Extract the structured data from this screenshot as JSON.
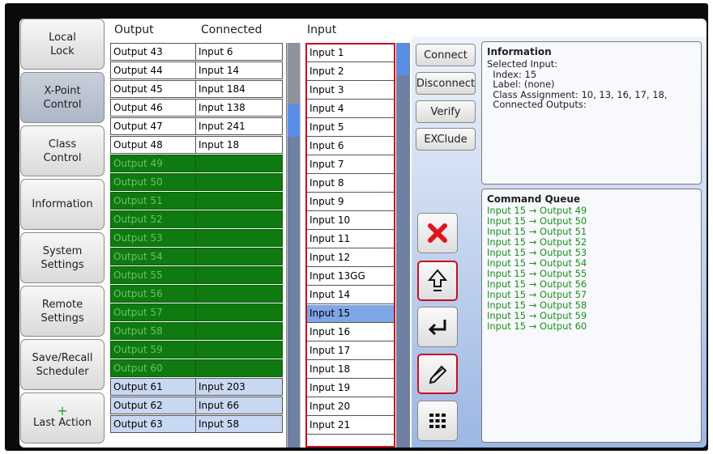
{
  "nav": [
    {
      "label": "Local\nLock",
      "active": false
    },
    {
      "label": "X-Point\nControl",
      "active": true
    },
    {
      "label": "Class\nControl",
      "active": false
    },
    {
      "label": "Information",
      "active": false
    },
    {
      "label": "System\nSettings",
      "active": false
    },
    {
      "label": "Remote\nSettings",
      "active": false
    },
    {
      "label": "Save/Recall\nScheduler",
      "active": false
    },
    {
      "label": "Last Action",
      "active": false,
      "plus": "+"
    }
  ],
  "headers": {
    "output": "Output",
    "connected": "Connected",
    "input": "Input"
  },
  "outputs": [
    {
      "output": "Output 43",
      "connected": "Input 6",
      "state": "normal"
    },
    {
      "output": "Output 44",
      "connected": "Input 14",
      "state": "normal"
    },
    {
      "output": "Output 45",
      "connected": "Input 184",
      "state": "normal"
    },
    {
      "output": "Output 46",
      "connected": "Input 138",
      "state": "normal"
    },
    {
      "output": "Output 47",
      "connected": "Input 241",
      "state": "normal"
    },
    {
      "output": "Output 48",
      "connected": "Input 18",
      "state": "normal"
    },
    {
      "output": "Output 49",
      "connected": "",
      "state": "queued"
    },
    {
      "output": "Output 50",
      "connected": "",
      "state": "queued"
    },
    {
      "output": "Output 51",
      "connected": "",
      "state": "queued"
    },
    {
      "output": "Output 52",
      "connected": "",
      "state": "queued"
    },
    {
      "output": "Output 53",
      "connected": "",
      "state": "queued"
    },
    {
      "output": "Output 54",
      "connected": "",
      "state": "queued"
    },
    {
      "output": "Output 55",
      "connected": "",
      "state": "queued"
    },
    {
      "output": "Output 56",
      "connected": "",
      "state": "queued"
    },
    {
      "output": "Output 57",
      "connected": "",
      "state": "queued"
    },
    {
      "output": "Output 58",
      "connected": "",
      "state": "queued"
    },
    {
      "output": "Output 59",
      "connected": "",
      "state": "queued"
    },
    {
      "output": "Output 60",
      "connected": "",
      "state": "queued"
    },
    {
      "output": "Output 61",
      "connected": "Input 203",
      "state": "highlight"
    },
    {
      "output": "Output 62",
      "connected": "Input 66",
      "state": "highlight"
    },
    {
      "output": "Output 63",
      "connected": "Input 58",
      "state": "highlight"
    }
  ],
  "inputs": [
    "Input 1",
    "Input 2",
    "Input 3",
    "Input 4",
    "Input 5",
    "Input 6",
    "Input 7",
    "Input 8",
    "Input 9",
    "Input 10",
    "Input 11",
    "Input 12",
    "Input 13GG",
    "Input 14",
    "Input 15",
    "Input 16",
    "Input 17",
    "Input 18",
    "Input 19",
    "Input 20",
    "Input 21"
  ],
  "selected_input": "Input 15",
  "actions": {
    "connect": "Connect",
    "disconnect": "Disconnect",
    "verify": "Verify",
    "exclude": "EXClude"
  },
  "icon_buttons": [
    "delete-icon",
    "upload-icon",
    "enter-icon",
    "edit-icon",
    "keypad-icon"
  ],
  "info": {
    "title": "Information",
    "lines": [
      "Selected Input:",
      "  Index: 15",
      "  Label: (none)",
      "  Class Assignment: 10, 13, 16, 17, 18,",
      "  Connected Outputs:"
    ]
  },
  "queue": {
    "title": "Command Queue",
    "items": [
      "Input 15 → Output 49",
      "Input 15 → Output 50",
      "Input 15 → Output 51",
      "Input 15 → Output 52",
      "Input 15 → Output 53",
      "Input 15 → Output 54",
      "Input 15 → Output 55",
      "Input 15 → Output 56",
      "Input 15 → Output 57",
      "Input 15 → Output 58",
      "Input 15 → Output 59",
      "Input 15 → Output 60"
    ]
  },
  "colors": {
    "queued": "#0f7a0f",
    "queue_text": "#1d8f1d",
    "selected": "#7fa6e6",
    "accent_red": "#c8101e"
  }
}
